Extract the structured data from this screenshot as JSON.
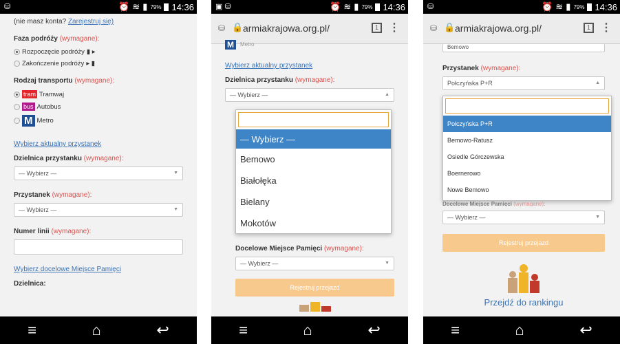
{
  "status": {
    "left_icon": "usb-icon",
    "battery_pct": "79%",
    "time": "14:36"
  },
  "browser": {
    "url": "armiakrajowa.org.pl/",
    "tabs_count": "1"
  },
  "screen1": {
    "register_prompt": "(nie masz konta?",
    "register_link": "Zarejestruj się)",
    "phase_label": "Faza podróży",
    "required": "(wymagane):",
    "phase_start": "Rozpoczęcie podróży",
    "phase_end": "Zakończenie podróży",
    "transport_label": "Rodzaj transportu",
    "tram_chip": "tram",
    "tram_label": "Tramwaj",
    "bus_chip": "bus",
    "bus_label": "Autobus",
    "metro_chip": "M",
    "metro_label": "Metro",
    "choose_stop_link": "Wybierz aktualny przystanek",
    "district_label": "Dzielnica przystanku",
    "select_placeholder": "— Wybierz —",
    "stop_label": "Przystanek",
    "line_label": "Numer linii",
    "memorial_link": "Wybierz docelowe Miejsce Pamięci",
    "district_short_label": "Dzielnica:"
  },
  "screen2": {
    "metro_label": "Metro",
    "choose_stop_link": "Wybierz aktualny przystanek",
    "district_label": "Dzielnica przystanku",
    "required": "(wymagane):",
    "select_placeholder": "— Wybierz —",
    "options": [
      "— Wybierz —",
      "Bemowo",
      "Białołęka",
      "Bielany",
      "Mokotów"
    ],
    "target_label": "Docelowe Miejsce Pamięci",
    "register_button": "Rejestruj przejazd"
  },
  "screen3": {
    "partial_top": "Bemowo",
    "stop_label": "Przystanek",
    "required": "(wymagane):",
    "selected_stop": "Połczyńska P+R",
    "options": [
      "Połczyńska P+R",
      "Bemowo-Ratusz",
      "Osiedle Górczewska",
      "Boernerowo",
      "Nowe Bemowo"
    ],
    "target_label": "Docelowe Miejsce Pamięci",
    "select_placeholder": "— Wybierz —",
    "register_button": "Rejestruj przejazd",
    "ranking_link": "Przejdź do rankingu"
  },
  "colors": {
    "accent_blue": "#3d85c6",
    "required_red": "#d9534f",
    "button_orange": "#f8c98c",
    "focus_orange": "#e8a33d"
  }
}
